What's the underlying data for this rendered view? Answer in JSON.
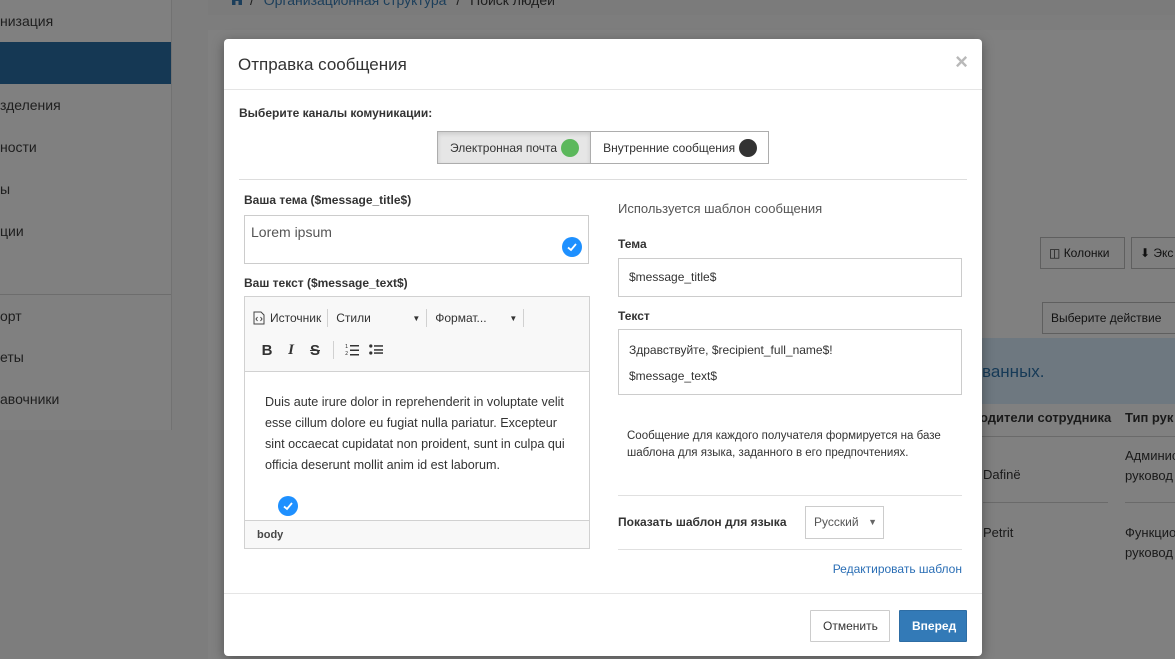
{
  "background": {
    "sidebar_items": [
      "низация",
      "",
      "зделения",
      "ности",
      "ы",
      "ции",
      "",
      "орт",
      "еты",
      "авочники"
    ],
    "breadcrumb": {
      "link": "Организационная структура",
      "separator": "/",
      "current": "Поиск людей"
    },
    "columns_button": "Колонки",
    "export_button": "Экс",
    "action_select": "Выберите действие",
    "info_text": "ванных.",
    "table_headers": [
      "одители сотрудника",
      "Тип рук"
    ],
    "rows": [
      {
        "col1": "Dafinë",
        "col2a": "Админис",
        "col2b": "руковод"
      },
      {
        "col1": "Petrit",
        "col2a": "Функцио",
        "col2b": "руковод"
      }
    ]
  },
  "modal": {
    "title": "Отправка сообщения",
    "close": "×",
    "channels_label": "Выберите каналы комуникации:",
    "channels": [
      {
        "label": "Электронная почта",
        "active": true,
        "color": "#5cb85c"
      },
      {
        "label": "Внутренние сообщения",
        "active": false,
        "color": "#333333"
      }
    ],
    "subject_label": "Ваша тема ($message_title$)",
    "subject_value": "Lorem ipsum",
    "text_label": "Ваш текст ($message_text$)",
    "editor": {
      "source": "Источник",
      "styles": "Стили",
      "format": "Формат...",
      "bold": "B",
      "italic": "I",
      "strike": "S",
      "body": "Duis aute irure dolor in reprehenderit in voluptate velit esse cillum dolore eu fugiat nulla pariatur. Excepteur sint occaecat cupidatat non proident, sunt in culpa qui officia deserunt mollit anim id est laborum.",
      "path": "body"
    },
    "template": {
      "caption": "Используется шаблон сообщения",
      "subject_label": "Тема",
      "subject_value": "$message_title$",
      "text_label": "Текст",
      "text_line1": "Здравствуйте, $recipient_full_name$!",
      "text_line2": "$message_text$",
      "note": "Сообщение для каждого получателя формируется на базе шаблона для языка, заданного в его предпочтениях.",
      "lang_label": "Показать шаблон для языка",
      "lang_value": "Русский",
      "edit_link": "Редактировать шаблон"
    },
    "buttons": {
      "cancel": "Отменить",
      "next": "Вперед"
    }
  }
}
